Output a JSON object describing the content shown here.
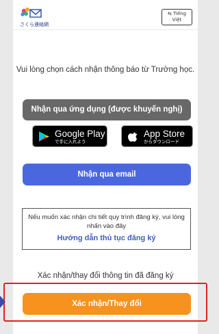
{
  "header": {
    "logo_text": "さくら連絡網",
    "language_button": {
      "line1": "Tiếng",
      "line2": "Việt",
      "icon": "translate-icon"
    }
  },
  "main": {
    "intro_text": "Vui lòng chọn cách nhận thông báo từ Trường học.",
    "app_button_label": "Nhận qua ứng dụng (được khuyến nghị)",
    "google_play": {
      "big": "Google Play",
      "small": "で手に入れよう",
      "icon": "google-play-icon"
    },
    "app_store": {
      "big": "App Store",
      "small": "からダウンロード",
      "icon": "apple-icon"
    },
    "email_button_label": "Nhận qua email",
    "info_box": {
      "note_line1": "Nếu muốn xác nhận chi tiết quy trình đăng ký, vui lòng",
      "note_line2": "nhấn vào đây",
      "link_text": "Hướng dẫn thủ tục đăng ký"
    },
    "confirm_label": "Xác nhận/thay đổi thông tin đã đăng ký",
    "confirm_button_label": "Xác nhận/Thay đổi"
  },
  "colors": {
    "app_button": "#686868",
    "email_button": "#4a67e0",
    "confirm_button": "#f7921e",
    "highlight": "#e02020",
    "link": "#3f5fb8"
  }
}
